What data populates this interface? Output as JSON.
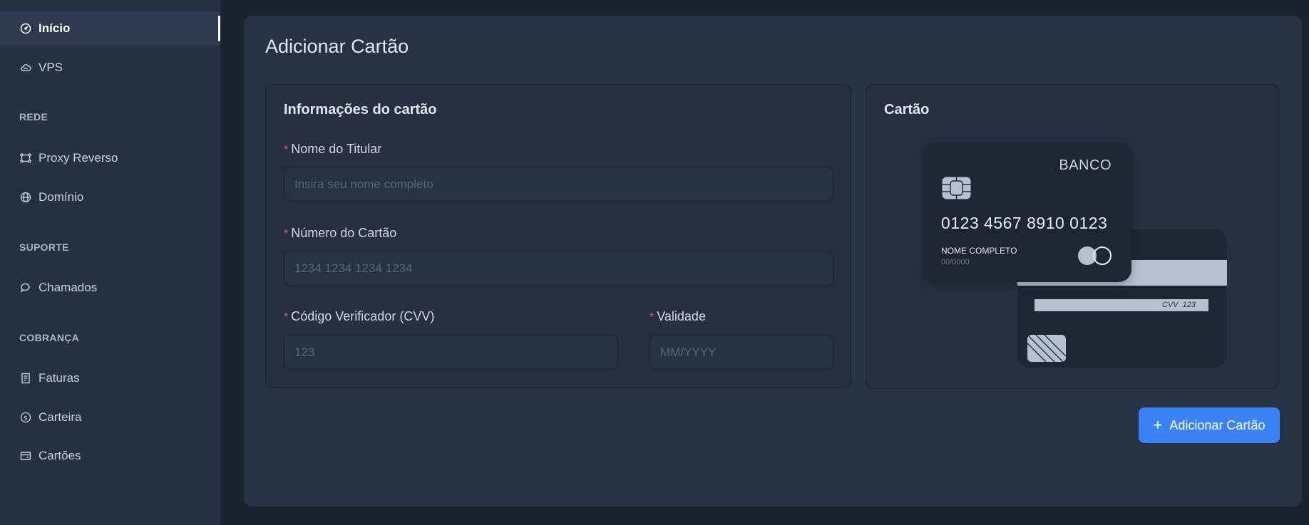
{
  "sidebar": {
    "items": [
      {
        "label": "Início",
        "icon": "dashboard-icon"
      },
      {
        "label": "VPS",
        "icon": "cloud-icon"
      },
      {
        "label": "Proxy Reverso",
        "icon": "proxy-icon"
      },
      {
        "label": "Domínio",
        "icon": "globe-icon"
      },
      {
        "label": "Chamados",
        "icon": "chat-icon"
      },
      {
        "label": "Faturas",
        "icon": "invoice-icon"
      },
      {
        "label": "Carteira",
        "icon": "dollar-icon"
      },
      {
        "label": "Cartões",
        "icon": "card-icon"
      }
    ],
    "sections": {
      "rede": "REDE",
      "suporte": "SUPORTE",
      "cobranca": "COBRANÇA"
    }
  },
  "main": {
    "title": "Adicionar Cartão",
    "form": {
      "title": "Informações do cartão",
      "required_mark": "*",
      "holder_label": "Nome do Titular",
      "holder_placeholder": "Insira seu nome completo",
      "holder_value": "",
      "number_label": "Número do Cartão",
      "number_placeholder": "1234 1234 1234 1234",
      "number_value": "",
      "cvv_label": "Código Verificador (CVV)",
      "cvv_placeholder": "123",
      "cvv_value": "",
      "expiry_label": "Validade",
      "expiry_placeholder": "MM/YYYY",
      "expiry_value": ""
    },
    "preview": {
      "title": "Cartão",
      "bank": "BANCO",
      "number": "0123 4567 8910 0123",
      "holder": "NOME COMPLETO",
      "expiry": "00/0000",
      "cvv_label": "CVV",
      "cvv_value": "123"
    },
    "submit_label": "Adicionar Cartão"
  },
  "colors": {
    "accent": "#3b82f6",
    "required": "#e05260",
    "sidebar_bg": "#253042",
    "panel_bg": "#273244"
  }
}
